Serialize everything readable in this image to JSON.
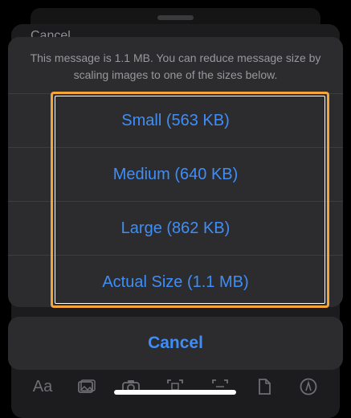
{
  "background": {
    "compose_title": "Cancel",
    "toolbar_icons": [
      "text-format-icon",
      "photo-icon",
      "camera-icon",
      "scan-icon",
      "scan-document-icon",
      "document-icon",
      "markup-icon"
    ],
    "toolbar_text_label": "Aa"
  },
  "action_sheet": {
    "message": "This message is 1.1 MB. You can reduce message size by scaling images to one of the sizes below.",
    "options": [
      {
        "label": "Small (563 KB)"
      },
      {
        "label": "Medium (640 KB)"
      },
      {
        "label": "Large (862 KB)"
      },
      {
        "label": "Actual Size (1.1 MB)"
      }
    ],
    "cancel_label": "Cancel"
  },
  "colors": {
    "accent": "#3f8ef7",
    "highlight": "#f5a43a",
    "sheet": "#2c2c2e",
    "background": "#000000"
  }
}
